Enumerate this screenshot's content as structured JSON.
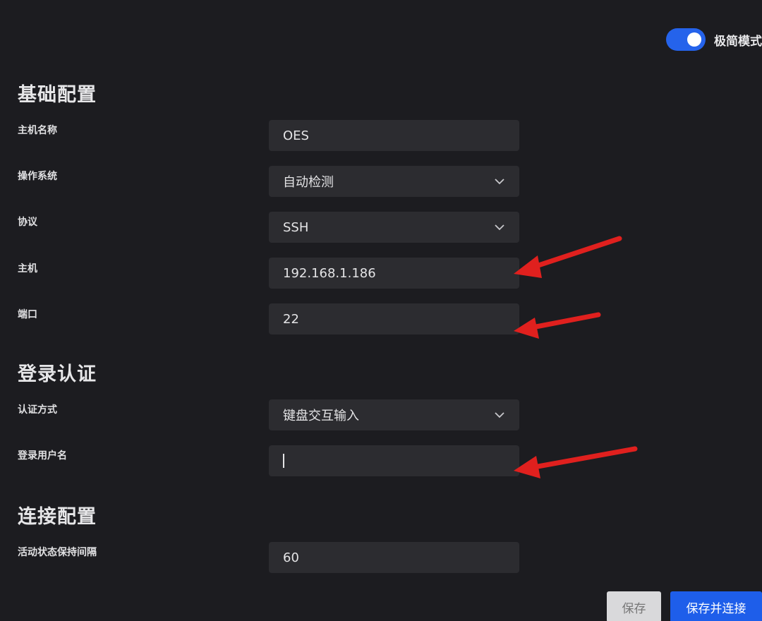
{
  "toggle": {
    "label": "极简模式",
    "on": true
  },
  "sections": {
    "basic": {
      "title": "基础配置",
      "fields": {
        "hostname": {
          "label": "主机名称",
          "value": "OES"
        },
        "os": {
          "label": "操作系统",
          "value": "自动检测"
        },
        "protocol": {
          "label": "协议",
          "value": "SSH"
        },
        "host": {
          "label": "主机",
          "value": "192.168.1.186"
        },
        "port": {
          "label": "端口",
          "value": "22"
        }
      }
    },
    "auth": {
      "title": "登录认证",
      "fields": {
        "method": {
          "label": "认证方式",
          "value": "键盘交互输入"
        },
        "username": {
          "label": "登录用户名",
          "value": ""
        }
      }
    },
    "connection": {
      "title": "连接配置",
      "fields": {
        "keepalive": {
          "label": "活动状态保持间隔",
          "value": "60"
        }
      }
    }
  },
  "buttons": {
    "save": "保存",
    "primary": "保存并连接"
  },
  "colors": {
    "background": "#1c1c20",
    "field": "#2c2c30",
    "accent": "#2563eb",
    "annotation": "#e0201e"
  },
  "icons": {
    "select": "chevron-down-icon",
    "annotation": "red-arrow-icon"
  }
}
